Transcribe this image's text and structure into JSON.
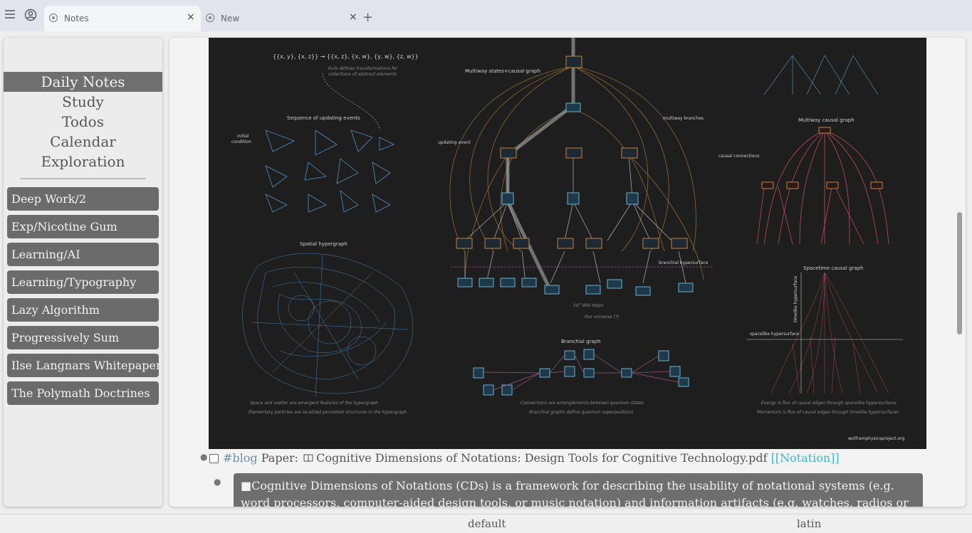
{
  "tabs": [
    {
      "title": "Notes",
      "active": true
    },
    {
      "title": "New",
      "active": false
    }
  ],
  "toolbar": {
    "menu_icon": "hamburger-menu-icon",
    "profile_icon": "user-circle-icon",
    "new_tab_label": "+",
    "close_label": "×"
  },
  "sidebar": {
    "nav": [
      {
        "label": "Daily Notes",
        "active": true
      },
      {
        "label": "Study",
        "active": false
      },
      {
        "label": "Todos",
        "active": false
      },
      {
        "label": "Calendar",
        "active": false
      },
      {
        "label": "Exploration",
        "active": false
      }
    ],
    "notes": [
      "Deep Work/2",
      "Exp/Nicotine Gum",
      "Learning/AI",
      "Learning/Typography",
      "Lazy Algorithm",
      "Progressively Sum",
      "Ilse Langnars Whitepaper",
      "The Polymath Doctrines"
    ]
  },
  "figure": {
    "labels": {
      "multiway": "Multiway states+causal graph",
      "sequence": "Sequence of updating events",
      "initial": "initial",
      "condition": "condition",
      "updating": "updating event",
      "branches": "multiway branches",
      "causal": "causal connections",
      "multiway_causal": "Multiway causal graph",
      "spatial": "Spatial hypergraph",
      "branchial_hyper": "branchial hypersurface",
      "spacetime": "Spacetime causal graph",
      "spacelike": "spacelike hypersurface",
      "timelike": "timelike hypersurface",
      "steps": "10^400 steps",
      "universe": "Our universe (?)",
      "branchial": "Branchial graph",
      "rule": "{{x, y}, {x, z}} → {{x, z}, {x, w}, {y, w}, {z, w}}",
      "rule_note1": "Rule defines transformations for",
      "rule_note2": "collections of abstract elements",
      "cap_space1": "Space and matter are emergent features of the hypergraph",
      "cap_space2": "Elementary particles are localized persistent structures in the hypergraph",
      "cap_branch1": "Connections are entanglements between quantum states",
      "cap_branch2": "Branchial graphs define quantum superpositions",
      "cap_time1": "Energy is flux of causal edges through spacelike hypersurfaces",
      "cap_time2": "Momentum is flux of causal edges through timelike hypersurfaces",
      "credit": "wolframphysicsproject.org"
    }
  },
  "content": {
    "tag": "#blog",
    "prefix": "Paper:",
    "book_icon": "open-book-icon",
    "title": "Cognitive Dimensions of Notations: Design Tools for Cognitive Technology.pdf",
    "link": "[[Notation]]",
    "quote_marker": "■",
    "quote": "Cognitive Dimensions of Notations (CDs) is a framework for describing the usability of notational systems (e.g. word processors, computer-aided design tools, or music notation) and information artifacts (e.g. watches, radios or central"
  },
  "status": {
    "left": "default",
    "right": "latin"
  },
  "colors": {
    "sidebar_active": "#6f6f6f",
    "note_button": "#6b6b6b",
    "link": "#3fb6c6",
    "tag": "#6f8fa8",
    "figure_bg": "#1e1e1e"
  }
}
